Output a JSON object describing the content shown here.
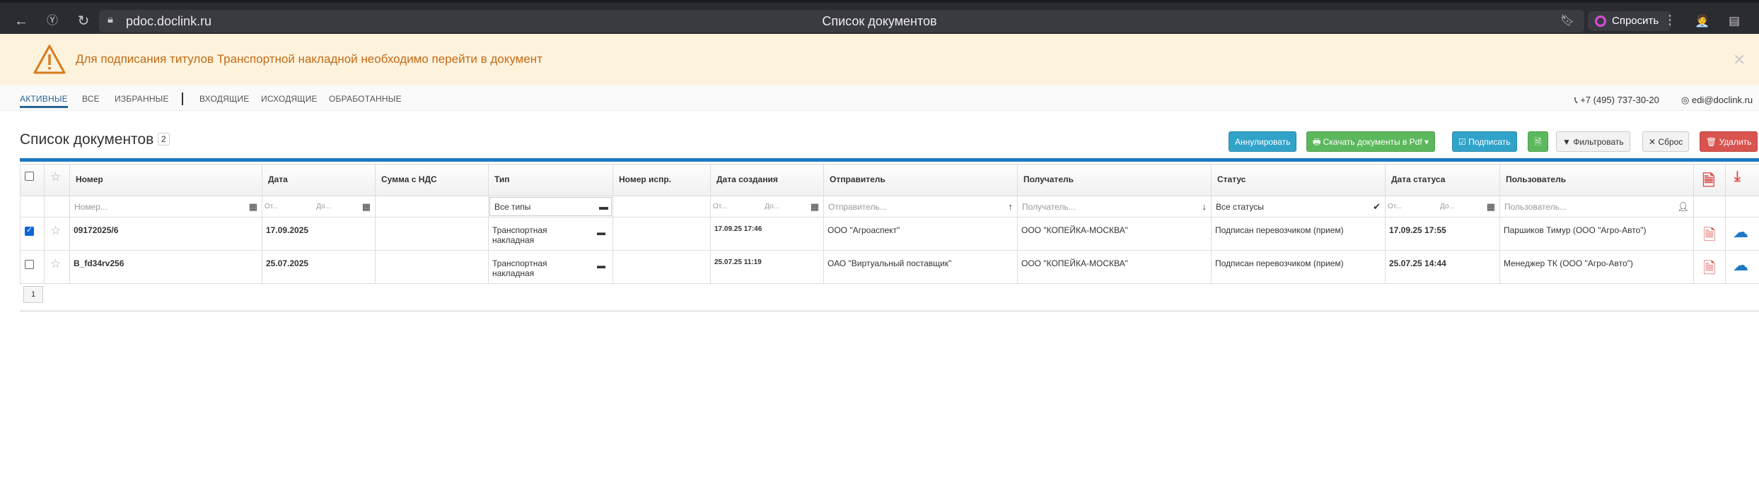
{
  "browser": {
    "url": "pdoc.doclink.ru",
    "title": "Список документов",
    "ask_label": "Спросить"
  },
  "banner": {
    "text": "Для подписания титулов Транспортной накладной необходимо перейти в документ"
  },
  "nav": {
    "tabs": [
      "АКТИВНЫЕ",
      "ВСЕ",
      "ИЗБРАННЫЕ",
      "ВХОДЯЩИЕ",
      "ИСХОДЯЩИЕ",
      "ОБРАБОТАННЫЕ"
    ],
    "phone": "+7 (495) 737-30-20",
    "email": "edi@doclink.ru"
  },
  "page": {
    "title": "Список документов",
    "count": "2"
  },
  "toolbar": {
    "annul": "Аннулировать",
    "download_pdf": "Скачать документы в Pdf",
    "sign": "Подписать",
    "filter": "Фильтровать",
    "reset": "Сброс",
    "delete": "Удалить"
  },
  "table": {
    "headers": {
      "number": "Номер",
      "date": "Дата",
      "sum": "Сумма с НДС",
      "type": "Тип",
      "corr_number": "Номер испр.",
      "created": "Дата создания",
      "sender": "Отправитель",
      "receiver": "Получатель",
      "status": "Статус",
      "status_date": "Дата статуса",
      "user": "Пользователь"
    },
    "filters": {
      "number": "Номер...",
      "from": "От...",
      "to": "До...",
      "type": "Все типы",
      "sender": "Отправитель...",
      "receiver": "Получатель...",
      "status": "Все статусы",
      "user": "Пользователь..."
    },
    "rows": [
      {
        "checked": true,
        "number": "09172025/6",
        "date": "17.09.2025",
        "sum": "",
        "type": "Транспортная накладная",
        "corr_number": "",
        "created": "17.09.25 17:46",
        "sender": "ООО \"Агроаспект\"",
        "receiver": "ООО \"КОПЕЙКА-МОСКВА\"",
        "status": "Подписан перевозчиком (прием)",
        "status_date": "17.09.25 17:55",
        "user": "Паршиков Тимур (ООО \"Агро-Авто\")"
      },
      {
        "checked": false,
        "number": "B_fd34rv256",
        "date": "25.07.2025",
        "sum": "",
        "type": "Транспортная накладная",
        "corr_number": "",
        "created": "25.07.25 11:19",
        "sender": "ОАО \"Виртуальный поставщик\"",
        "receiver": "ООО \"КОПЕЙКА-МОСКВА\"",
        "status": "Подписан перевозчиком (прием)",
        "status_date": "25.07.25 14:44",
        "user": "Менеджер ТК (ООО \"Агро-Авто\")"
      }
    ]
  },
  "pagination": {
    "current": "1"
  },
  "colors": {
    "accent": "#1e78c2",
    "warning": "#c36a16",
    "danger": "#d9534f",
    "success": "#5cb85c",
    "info": "#31a3c9"
  }
}
